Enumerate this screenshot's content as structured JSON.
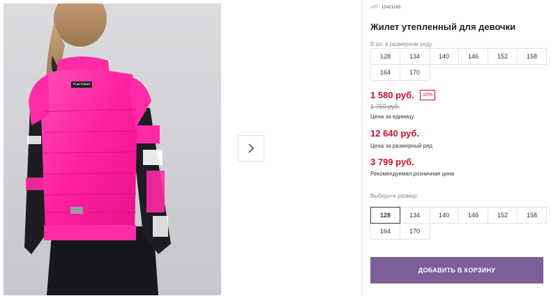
{
  "product": {
    "article_label": "АРТ:",
    "article_number": "12421165",
    "title": "Жилет утепленный для девочки",
    "photo_logo_text": "PLAYTODAY"
  },
  "gallery": {
    "next_icon": "chevron-right-icon"
  },
  "sizes_in_row": {
    "label": "В шт. в размерном ряду",
    "items": [
      "128",
      "134",
      "140",
      "146",
      "152",
      "158",
      "164",
      "170"
    ]
  },
  "prices": {
    "unit_price": "1 580 руб.",
    "discount": "10%",
    "old_price": "1 750 руб.",
    "unit_caption": "Цена за единицу",
    "row_price": "12 640 руб.",
    "row_caption": "Цена за размерный ряд",
    "retail_price": "3 799 руб.",
    "retail_caption": "Рекомендуемая розничная цена"
  },
  "size_select": {
    "label": "Выберите размер:",
    "selected": "128",
    "items": [
      "128",
      "134",
      "140",
      "146",
      "152",
      "158",
      "164",
      "170"
    ]
  },
  "cart": {
    "add_label": "ДОБАВИТЬ В КОРЗИНУ"
  },
  "colors": {
    "accent": "#7b5f98",
    "price_red": "#c8102e",
    "vest_pink": "#ff1f9e"
  }
}
